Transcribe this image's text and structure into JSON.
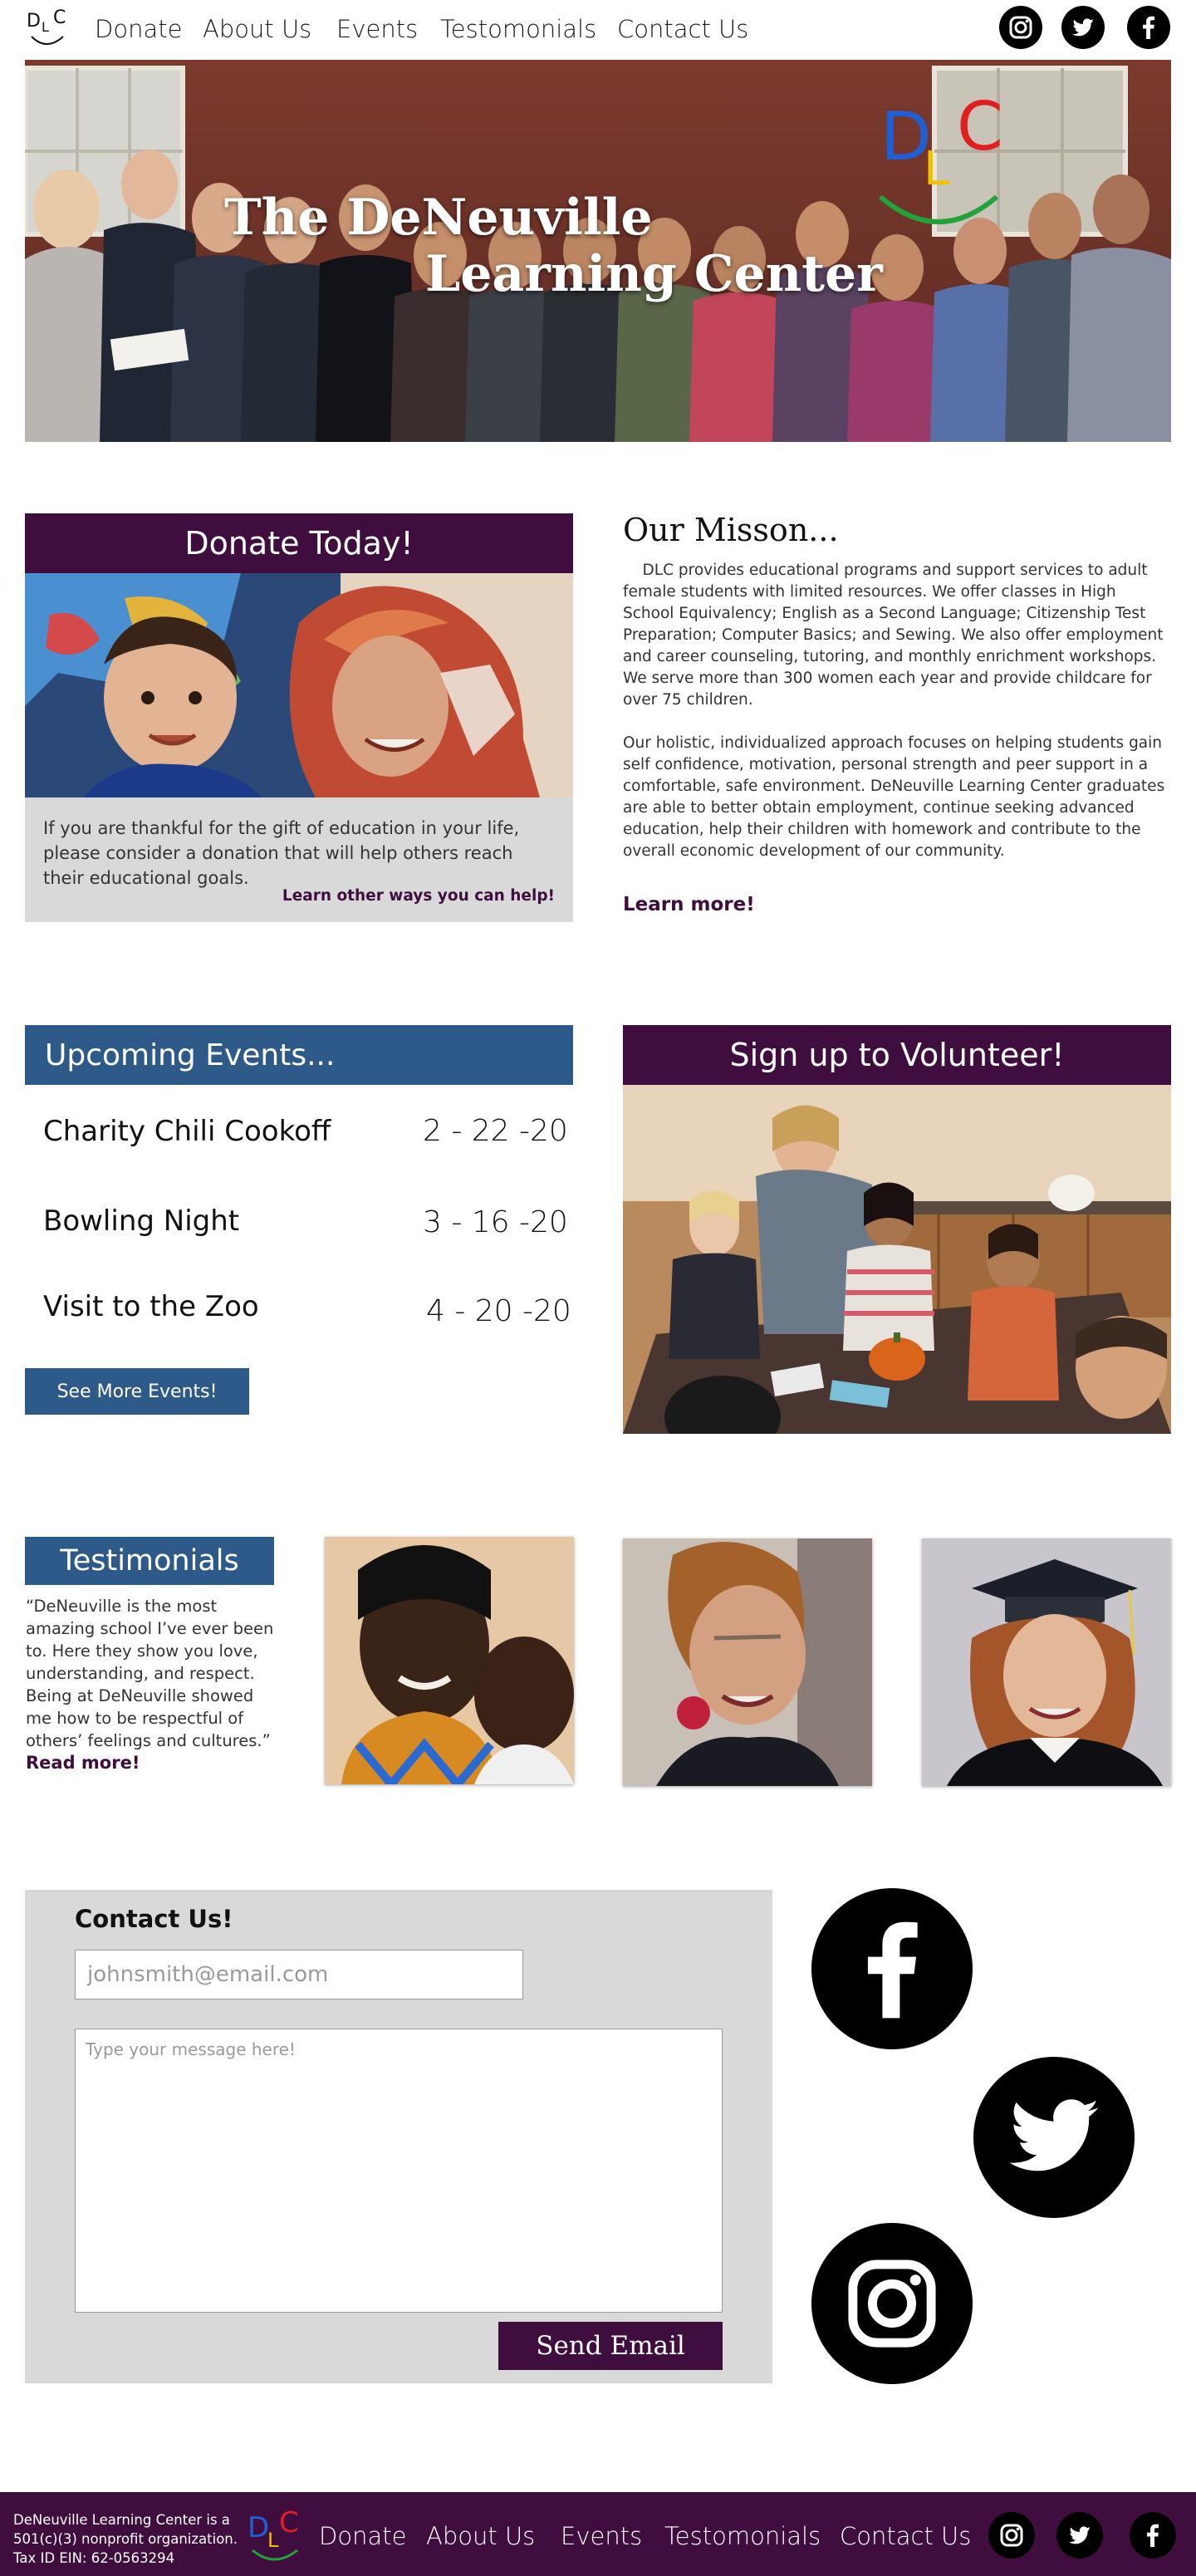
{
  "header": {
    "nav": [
      "Donate",
      "About Us",
      "Events",
      "Testomonials",
      "Contact Us"
    ],
    "social_icons": [
      "instagram-icon",
      "twitter-icon",
      "facebook-icon"
    ]
  },
  "hero": {
    "title_line1": "The DeNeuville",
    "title_line2": "Learning Center",
    "logo_letters": [
      "D",
      "L",
      "C"
    ]
  },
  "donate": {
    "heading": "Donate Today!",
    "text": "If you are thankful for the gift of education in your life, please consider a donation that will help others reach their educational goals.",
    "link": "Learn other ways you can help!"
  },
  "mission": {
    "heading": "Our Misson...",
    "p1": "    DLC provides educational programs and support services to adult female students with limited resources. We offer classes in High School Equivalency; English as a Second Language; Citizenship Test Preparation; Computer Basics; and Sewing. We also offer employment and career counseling, tutoring, and monthly enrichment workshops. We serve more than 300 women each year and provide childcare for over 75 children.",
    "p2": "Our holistic, individualized approach focuses on helping students gain self confidence, motivation, personal strength and peer support in a comfortable, safe environment. DeNeuville Learning Center graduates are able to better obtain employment, continue seeking advanced education, help their children with homework and contribute to the overall economic development of our community.",
    "link": "Learn more!"
  },
  "events": {
    "heading": "Upcoming Events...",
    "items": [
      {
        "name": "Charity Chili Cookoff",
        "date": "2 - 22 -20"
      },
      {
        "name": "Bowling Night",
        "date": "3 - 16 -20"
      },
      {
        "name": "Visit to the Zoo",
        "date": "4 - 20 -20"
      }
    ],
    "button": "See More Events!"
  },
  "volunteer": {
    "heading": "Sign up to Volunteer!"
  },
  "testimonials": {
    "heading": "Testimonials",
    "quote": "“DeNeuville is the most amazing school I’ve ever been to. Here they show you love, understanding, and respect. Being at DeNeuville showed me how to be respectful of others’ feelings and cultures.”",
    "link": "Read more!"
  },
  "contact": {
    "heading": "Contact Us!",
    "email_placeholder": "johnsmith@email.com",
    "message_placeholder": "Type your message here!",
    "button": "Send Email"
  },
  "footer": {
    "org_line1": "DeNeuville Learning Center is a",
    "org_line2": "501(c)(3) nonprofit organization.",
    "org_line3": "Tax ID EIN: 62-0563294",
    "nav": [
      "Donate",
      "About Us",
      "Events",
      "Testomonials",
      "Contact Us"
    ]
  },
  "colors": {
    "purple": "#3f0e3f",
    "blue": "#2d5a88",
    "panel_gray": "#d9d9d9",
    "logo_blue": "#1f5fd6",
    "logo_yellow": "#f2c200",
    "logo_red": "#e02020",
    "logo_green": "#22a33a"
  }
}
